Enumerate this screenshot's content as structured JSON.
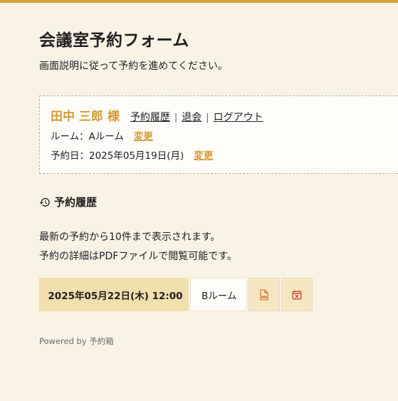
{
  "header": {
    "title": "会議室予約フォーム",
    "description": "画面説明に従って予約を進めてください。"
  },
  "user": {
    "name": "田中 三郎 様",
    "links": {
      "history": "予約履歴",
      "withdraw": "退会",
      "logout": "ログアウト"
    },
    "separator": "|",
    "room_label": "ルーム：Aルーム",
    "room_change": "変更",
    "date_label": "予約日：2025年05月19日(月)",
    "date_change": "変更"
  },
  "history": {
    "heading": "予約履歴",
    "desc_line1": "最新の予約から10件まで表示されます。",
    "desc_line2": "予約の詳細はPDFファイルで閲覧可能です。",
    "rows": [
      {
        "datetime": "2025年05月22日(木) 12:00",
        "room": "Bルーム",
        "pdf_icon": "pdf-file-icon",
        "cancel_icon": "calendar-cancel-icon"
      }
    ]
  },
  "footer": {
    "powered_by": "Powered by 予約箱"
  },
  "colors": {
    "accent": "#d49a35",
    "background": "#f9f3e6",
    "highlight": "#f2dfae",
    "icon": "#d97a3a"
  }
}
